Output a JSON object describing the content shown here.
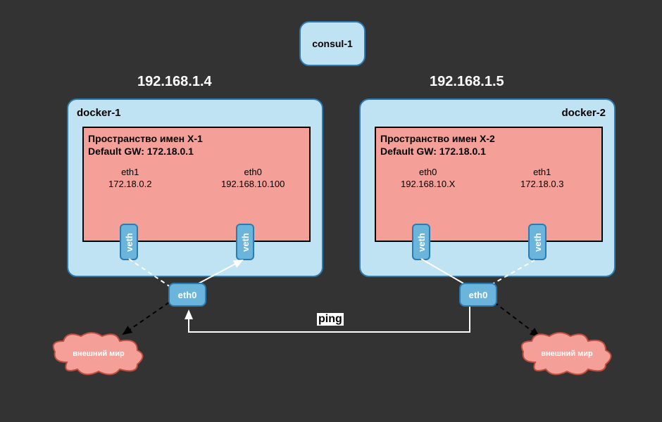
{
  "consul": {
    "label": "consul-1"
  },
  "host_left": {
    "ip": "192.168.1.4",
    "docker_label": "docker-1",
    "namespace": {
      "title_line1": "Пространство имен X-1",
      "title_line2": "Default GW: 172.18.0.1",
      "ifaces": {
        "left": {
          "name": "eth1",
          "ip": "172.18.0.2"
        },
        "right": {
          "name": "eth0",
          "ip": "192.168.10.100"
        }
      }
    },
    "veth_label": "veth",
    "eth0_label": "eth0",
    "cloud_label": "внешний мир"
  },
  "host_right": {
    "ip": "192.168.1.5",
    "docker_label": "docker-2",
    "namespace": {
      "title_line1": "Пространство имен X-2",
      "title_line2": "Default GW: 172.18.0.1",
      "ifaces": {
        "left": {
          "name": "eth0",
          "ip": "192.168.10.X"
        },
        "right": {
          "name": "eth1",
          "ip": "172.18.0.3"
        }
      }
    },
    "veth_label": "veth",
    "eth0_label": "eth0",
    "cloud_label": "внешний мир"
  },
  "ping_label": "ping",
  "colors": {
    "bg": "#333333",
    "box_fill": "#bfe3f2",
    "box_stroke": "#2b7ab0",
    "ns_fill": "#f4a098",
    "veth_fill": "#6bb4db",
    "cloud_fill": "#f4a098",
    "cloud_stroke": "#c14d3f"
  }
}
